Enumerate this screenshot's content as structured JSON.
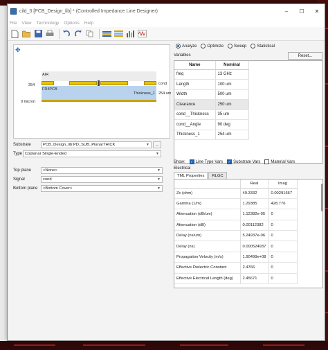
{
  "window": {
    "title": "cild_3 [PCB_Design_lib] * (Controlled Impedance Line Designer)",
    "minimize": "–",
    "maximize": "☐",
    "close": "✕"
  },
  "menu": [
    "File",
    "View",
    "Technology",
    "Options",
    "Help"
  ],
  "toolbar_icons": [
    "new-icon",
    "open-icon",
    "save-icon",
    "print-icon",
    "undo-icon",
    "redo-icon",
    "copy-icon",
    "bar-chart-icon",
    "stack-chart-icon",
    "multi-chart-icon",
    "waveform-icon"
  ],
  "stackup": {
    "air_label": "AIR",
    "substrate_label": "FR4PCB",
    "thickness_label": "Thickness_1",
    "thickness_value": "254 um",
    "cond_label": "cond",
    "y_254": "254",
    "y_0": "0 micron"
  },
  "form": {
    "substrate_label": "Substrate",
    "substrate_value": "PCB_Design_lib:PD_SUB_PlanarTHICK",
    "substrate_more": "...",
    "type_label": "Type",
    "type_value": "Coplanar Single-Ended",
    "top_plane_label": "Top plane",
    "top_plane_value": "<None>",
    "signal_label": "Signal",
    "signal_value": "cond",
    "bottom_plane_label": "Bottom plane",
    "bottom_plane_value": "<Bottom Cover>"
  },
  "modes": {
    "analyze": "Analyze",
    "optimize": "Optimize",
    "sweep": "Sweep",
    "statistical": "Statistical"
  },
  "variables": {
    "section_label": "Variables",
    "reset_label": "Reset...",
    "col_name": "Name",
    "col_nominal": "Nominal",
    "rows": [
      {
        "name": "freq",
        "nominal": "13 GHz"
      },
      {
        "name": "Length",
        "nominal": "100 um"
      },
      {
        "name": "Width",
        "nominal": "500 um"
      },
      {
        "name": "Clearance",
        "nominal": "250 um"
      },
      {
        "name": "cond__Thickness",
        "nominal": "35 um"
      },
      {
        "name": "cond__Angle",
        "nominal": "90 deg"
      },
      {
        "name": "Thickness_1",
        "nominal": "254 um"
      }
    ]
  },
  "show": {
    "label": "Show:",
    "line_type_vars": "Line Type Vars",
    "substrate_vars": "Substrate Vars",
    "material_vars": "Material Vars"
  },
  "electrical": {
    "section_label": "Electrical",
    "tab_tml": "TML Properties",
    "tab_rlgc": "RLGC",
    "col_real": "Real",
    "col_imag": "Imag",
    "rows": [
      {
        "name": "Zc (ohm)",
        "real": "49.3332",
        "imag": "0.00291667"
      },
      {
        "name": "Gamma (1/m)",
        "real": "1.29385",
        "imag": "428.776"
      },
      {
        "name": "Attenuation (dB/um)",
        "real": "1.12382e-05",
        "imag": "0"
      },
      {
        "name": "Attenuation (dB)",
        "real": "0.00112382",
        "imag": "0"
      },
      {
        "name": "Delay (ns/um)",
        "real": "5.24937e-06",
        "imag": "0"
      },
      {
        "name": "Delay (ns)",
        "real": "0.000524937",
        "imag": "0"
      },
      {
        "name": "Propagation Velocity (m/s)",
        "real": "1.90499e+08",
        "imag": "0"
      },
      {
        "name": "Effective Dielectric Constant",
        "real": "2.4766",
        "imag": "0"
      },
      {
        "name": "Effective Electrical Length (deg)",
        "real": "2.45671",
        "imag": "0"
      }
    ]
  }
}
